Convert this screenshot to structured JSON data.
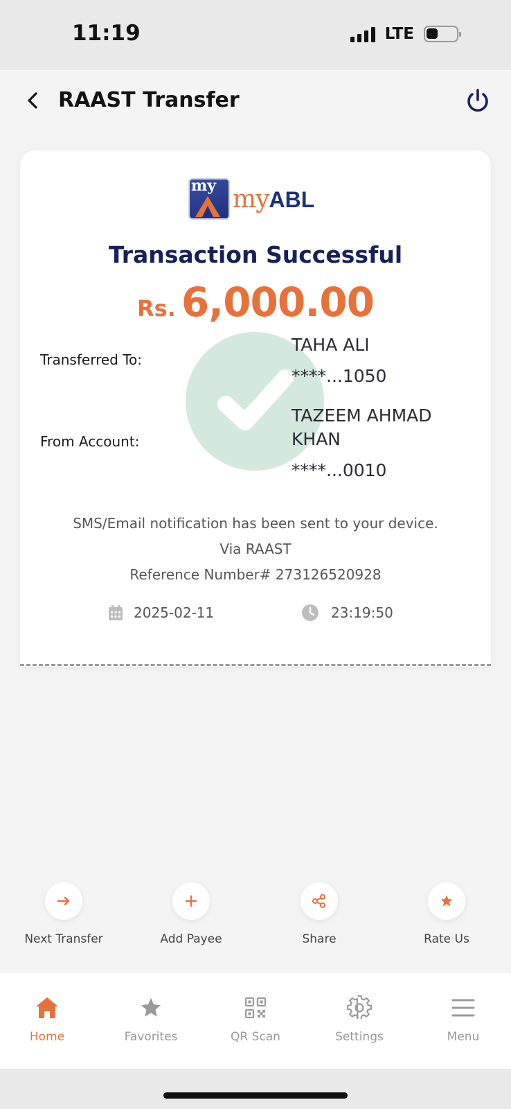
{
  "status_bar": {
    "time": "11:19",
    "network": "LTE"
  },
  "header": {
    "title": "RAAST Transfer"
  },
  "receipt": {
    "logo_text_my": "my",
    "logo_text_abl": "ABL",
    "logo_mark_text": "my",
    "title": "Transaction Successful",
    "currency": "Rs.",
    "amount": "6,000.00",
    "transferred_to_label": "Transferred To:",
    "transferred_to_name": "TAHA ALI",
    "transferred_to_account": "****...1050",
    "from_account_label": "From Account:",
    "from_account_name_line1": "TAZEEM AHMAD",
    "from_account_name_line2": "KHAN",
    "from_account_number": "****...0010",
    "notification": "SMS/Email notification has been sent to your device.",
    "via": "Via RAAST",
    "reference": "Reference Number# 273126520928",
    "date": "2025-02-11",
    "time": "23:19:50"
  },
  "quick_actions": [
    {
      "label": "Next Transfer",
      "icon": "arrow-right-icon"
    },
    {
      "label": "Add Payee",
      "icon": "plus-icon"
    },
    {
      "label": "Share",
      "icon": "share-icon"
    },
    {
      "label": "Rate Us",
      "icon": "star-icon"
    }
  ],
  "bottom_nav": [
    {
      "label": "Home",
      "icon": "home-icon",
      "active": true
    },
    {
      "label": "Favorites",
      "icon": "star-icon"
    },
    {
      "label": "QR Scan",
      "icon": "qr-icon"
    },
    {
      "label": "Settings",
      "icon": "gear-icon"
    },
    {
      "label": "Menu",
      "icon": "hamburger-icon"
    }
  ],
  "colors": {
    "accent": "#e8713a",
    "navy": "#172159",
    "success": "#d4e9dd"
  }
}
